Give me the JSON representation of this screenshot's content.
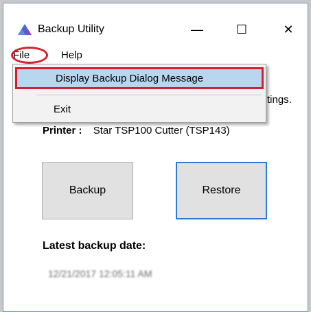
{
  "window": {
    "title": "Backup Utility",
    "app_icon": "backup-utility-icon",
    "controls": {
      "minimize": "—",
      "maximize": "☐",
      "close": "✕"
    }
  },
  "menubar": {
    "items": [
      {
        "label": "File"
      },
      {
        "label": "Help"
      }
    ]
  },
  "file_menu": {
    "items": [
      {
        "label": "Display Backup Dialog Message",
        "highlighted": true
      },
      {
        "label": "Exit"
      }
    ]
  },
  "body": {
    "obscured_text_tail": "tings.",
    "printer_label": "Printer :",
    "printer_value": "Star TSP100 Cutter (TSP143)",
    "backup_button": "Backup",
    "restore_button": "Restore",
    "latest_backup_label": "Latest backup date:",
    "latest_backup_value": "12/21/2017 12:05:11 AM"
  },
  "colors": {
    "annotation_red": "#d81e2a",
    "menu_highlight": "#b8d6f0",
    "focus_border": "#2a79d6"
  }
}
